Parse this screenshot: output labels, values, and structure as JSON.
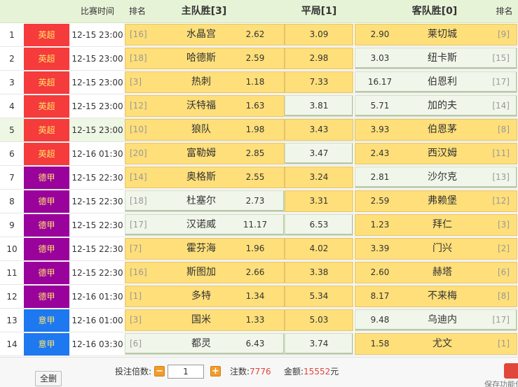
{
  "header": {
    "time_label": "比赛时间",
    "rank_label": "排名",
    "home_label": "主队胜[3]",
    "draw_label": "平局[1]",
    "away_label": "客队胜[0]",
    "rank_label_right": "排名"
  },
  "colors": {
    "epl": "#f53b3b",
    "bundesliga": "#99039b",
    "serie_a": "#1e78f0",
    "selected": "#fedf7a",
    "unselected": "#f1f6ea"
  },
  "rows": [
    {
      "num": "1",
      "league": "英超",
      "lc": "#f53b3b",
      "time": "12-15 23:00",
      "hr": "[16]",
      "home": "水晶宫",
      "ho": "2.62",
      "hs": true,
      "d": "3.09",
      "ds": true,
      "ao": "2.90",
      "as": true,
      "away": "莱切城",
      "ar": "[9]"
    },
    {
      "num": "2",
      "league": "英超",
      "lc": "#f53b3b",
      "time": "12-15 23:00",
      "hr": "[18]",
      "home": "哈德斯",
      "ho": "2.59",
      "hs": true,
      "d": "2.98",
      "ds": true,
      "ao": "3.03",
      "as": false,
      "away": "纽卡斯",
      "ar": "[15]"
    },
    {
      "num": "3",
      "league": "英超",
      "lc": "#f53b3b",
      "time": "12-15 23:00",
      "hr": "[3]",
      "home": "热刺",
      "ho": "1.18",
      "hs": true,
      "d": "7.33",
      "ds": true,
      "ao": "16.17",
      "as": false,
      "away": "伯恩利",
      "ar": "[17]"
    },
    {
      "num": "4",
      "league": "英超",
      "lc": "#f53b3b",
      "time": "12-15 23:00",
      "hr": "[12]",
      "home": "沃特福",
      "ho": "1.63",
      "hs": true,
      "d": "3.81",
      "ds": false,
      "ao": "5.71",
      "as": false,
      "away": "加的夫",
      "ar": "[14]"
    },
    {
      "num": "5",
      "league": "英超",
      "lc": "#f53b3b",
      "time": "12-15 23:00",
      "hr": "[10]",
      "home": "狼队",
      "ho": "1.98",
      "hs": true,
      "d": "3.43",
      "ds": true,
      "ao": "3.93",
      "as": true,
      "away": "伯恩茅",
      "ar": "[8]"
    },
    {
      "num": "6",
      "league": "英超",
      "lc": "#f53b3b",
      "time": "12-16 01:30",
      "hr": "[20]",
      "home": "富勒姆",
      "ho": "2.85",
      "hs": true,
      "d": "3.47",
      "ds": false,
      "ao": "2.43",
      "as": true,
      "away": "西汉姆",
      "ar": "[11]"
    },
    {
      "num": "7",
      "league": "德甲",
      "lc": "#99039b",
      "time": "12-15 22:30",
      "hr": "[14]",
      "home": "奥格斯",
      "ho": "2.55",
      "hs": true,
      "d": "3.24",
      "ds": true,
      "ao": "2.81",
      "as": false,
      "away": "沙尔克",
      "ar": "[13]"
    },
    {
      "num": "8",
      "league": "德甲",
      "lc": "#99039b",
      "time": "12-15 22:30",
      "hr": "[18]",
      "home": "杜塞尔",
      "ho": "2.73",
      "hs": false,
      "d": "3.31",
      "ds": true,
      "ao": "2.59",
      "as": true,
      "away": "弗赖堡",
      "ar": "[12]"
    },
    {
      "num": "9",
      "league": "德甲",
      "lc": "#99039b",
      "time": "12-15 22:30",
      "hr": "[17]",
      "home": "汉诺威",
      "ho": "11.17",
      "hs": false,
      "d": "6.53",
      "ds": false,
      "ao": "1.23",
      "as": true,
      "away": "拜仁",
      "ar": "[3]"
    },
    {
      "num": "10",
      "league": "德甲",
      "lc": "#99039b",
      "time": "12-15 22:30",
      "hr": "[7]",
      "home": "霍芬海",
      "ho": "1.96",
      "hs": true,
      "d": "4.02",
      "ds": true,
      "ao": "3.39",
      "as": true,
      "away": "门兴",
      "ar": "[2]"
    },
    {
      "num": "11",
      "league": "德甲",
      "lc": "#99039b",
      "time": "12-15 22:30",
      "hr": "[16]",
      "home": "斯图加",
      "ho": "2.66",
      "hs": true,
      "d": "3.38",
      "ds": true,
      "ao": "2.60",
      "as": true,
      "away": "赫塔",
      "ar": "[6]"
    },
    {
      "num": "12",
      "league": "德甲",
      "lc": "#99039b",
      "time": "12-16 01:30",
      "hr": "[1]",
      "home": "多特",
      "ho": "1.34",
      "hs": true,
      "d": "5.34",
      "ds": true,
      "ao": "8.17",
      "as": true,
      "away": "不来梅",
      "ar": "[8]"
    },
    {
      "num": "13",
      "league": "意甲",
      "lc": "#1e78f0",
      "time": "12-16 01:00",
      "hr": "[3]",
      "home": "国米",
      "ho": "1.33",
      "hs": true,
      "d": "5.03",
      "ds": true,
      "ao": "9.48",
      "as": false,
      "away": "乌迪内",
      "ar": "[17]"
    },
    {
      "num": "14",
      "league": "意甲",
      "lc": "#1e78f0",
      "time": "12-16 03:30",
      "hr": "[6]",
      "home": "都灵",
      "ho": "6.43",
      "hs": false,
      "d": "3.74",
      "ds": false,
      "ao": "1.58",
      "as": true,
      "away": "尤文",
      "ar": "[1]"
    }
  ],
  "footer": {
    "clear_label": "全删",
    "multiplier_label": "投注倍数:",
    "multiplier_value": "1",
    "minus": "−",
    "plus": "+",
    "notes_label": "注数:",
    "notes_value": "7776",
    "amount_label": "金额:",
    "amount_value": "15552",
    "amount_unit": "元",
    "func_label": "保存功能位"
  }
}
